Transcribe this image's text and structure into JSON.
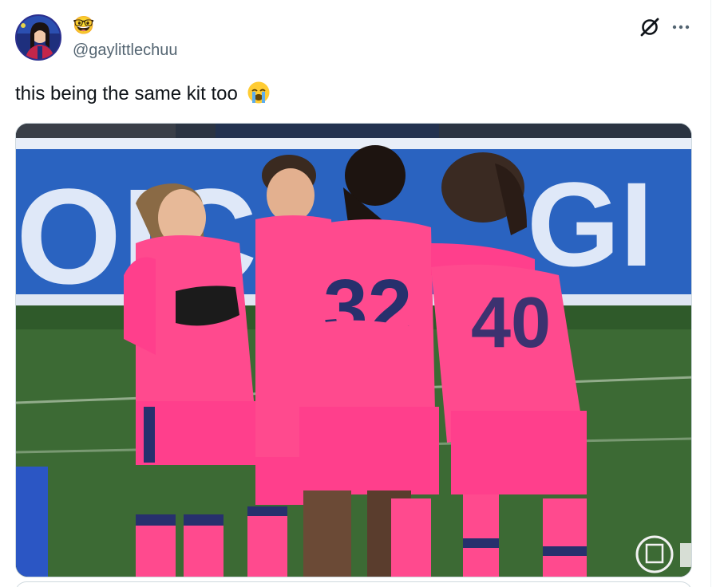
{
  "tweet": {
    "display_name_emoji": "🤓",
    "handle": "@gaylittlechuu",
    "text": "this being the same kit too",
    "text_emoji": "😭",
    "media": {
      "description_icon": "video-still",
      "jersey_numbers": [
        "32",
        "40"
      ]
    }
  },
  "icons": {
    "grok": "grok-icon",
    "more": "more-options-icon",
    "avatar": "avatar"
  },
  "colors": {
    "kit_pink": "#ff3f8c",
    "kit_navy": "#27306d",
    "board_blue": "#2a67c4",
    "pitch_green": "#3f6b35",
    "secondary_text": "#536471"
  }
}
